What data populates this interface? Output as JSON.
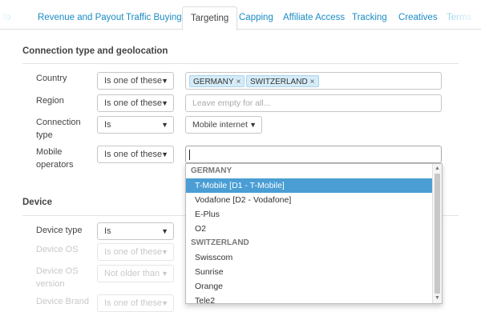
{
  "tabs": [
    {
      "label": "Info"
    },
    {
      "label": "Revenue and Payout"
    },
    {
      "label": "Traffic Buying"
    },
    {
      "label": "Targeting"
    },
    {
      "label": "Capping"
    },
    {
      "label": "Affiliate Access"
    },
    {
      "label": "Tracking"
    },
    {
      "label": "Creatives"
    },
    {
      "label": "Terms"
    }
  ],
  "active_tab": "Targeting",
  "connection_section": {
    "title": "Connection type and geolocation",
    "country": {
      "label": "Country",
      "operator": "Is one of these",
      "chips": [
        "GERMANY",
        "SWITZERLAND"
      ]
    },
    "region": {
      "label": "Region",
      "operator": "Is one of these",
      "placeholder": "Leave empty for all..."
    },
    "connection_type": {
      "label_line1": "Connection",
      "label_line2": "type",
      "operator": "Is",
      "value": "Mobile internet"
    },
    "mobile_operators": {
      "label_line1": "Mobile",
      "label_line2": "operators",
      "operator": "Is one of these",
      "value": ""
    }
  },
  "dropdown": {
    "groups": [
      {
        "name": "GERMANY",
        "options": [
          "T-Mobile [D1 - T-Mobile]",
          "Vodafone [D2 - Vodafone]",
          "E-Plus",
          "O2"
        ]
      },
      {
        "name": "SWITZERLAND",
        "options": [
          "Swisscom",
          "Sunrise",
          "Orange",
          "Tele2"
        ]
      }
    ],
    "highlighted": "T-Mobile [D1 - T-Mobile]"
  },
  "device_section": {
    "title": "Device",
    "device_type": {
      "label": "Device type",
      "operator": "Is"
    },
    "device_os": {
      "label": "Device OS",
      "operator": "Is one of these"
    },
    "device_os_version": {
      "label_line1": "Device OS",
      "label_line2": "version",
      "operator": "Not older than"
    },
    "device_brand": {
      "label": "Device Brand",
      "operator": "Is one of these"
    }
  },
  "icons": {
    "dropdown_arrow": "▼",
    "remove_chip": "×",
    "scroll_up": "▲",
    "scroll_down": "▼"
  }
}
